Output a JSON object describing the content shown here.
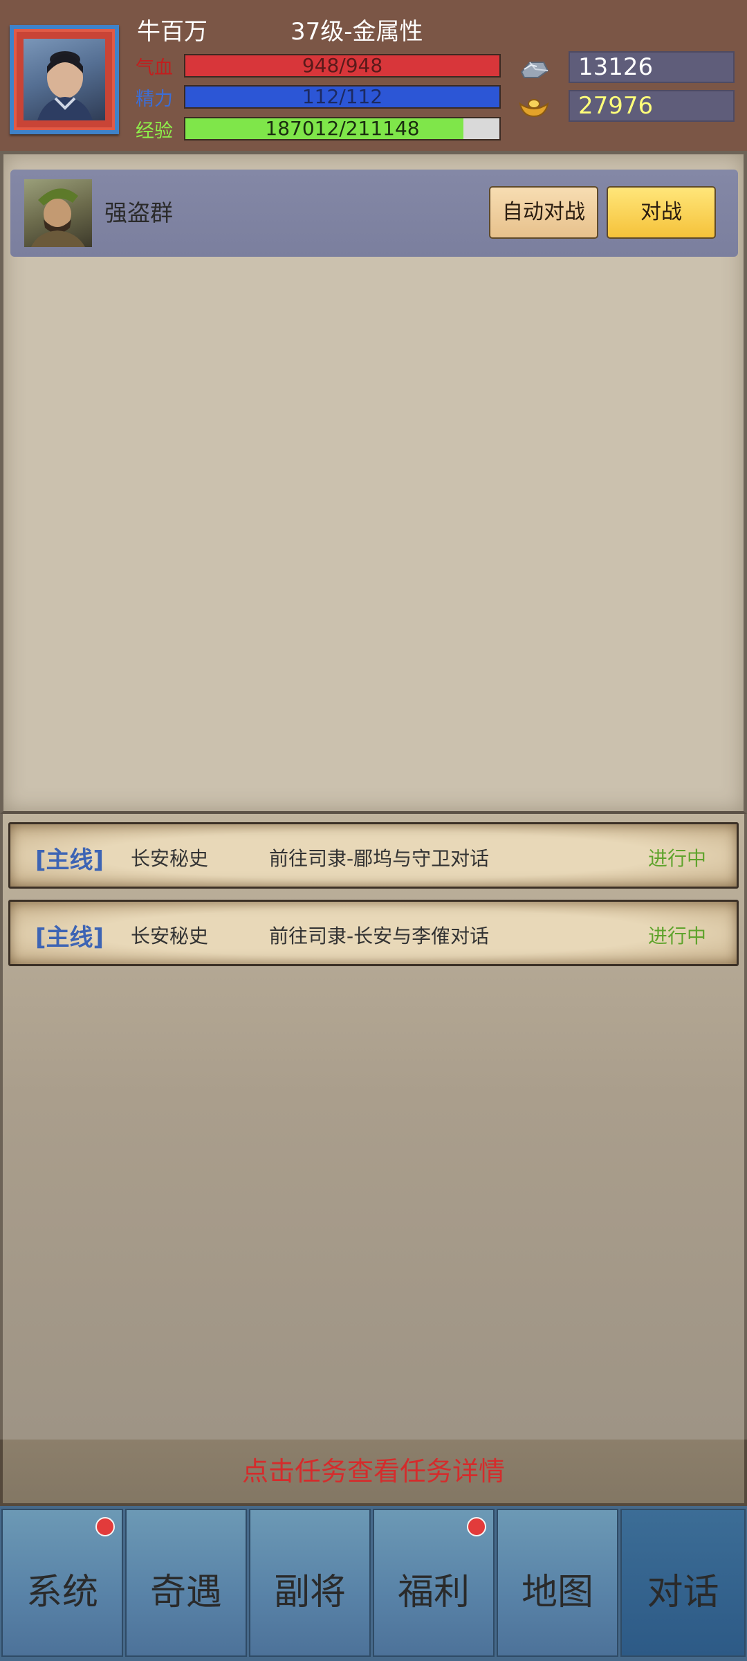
{
  "player": {
    "name": "牛百万",
    "level_text": "37级-金属性",
    "stats": {
      "hp": {
        "label": "气血",
        "text": "948/948",
        "fill": 1.0,
        "color": "#d8363a",
        "label_color": "#c21e1e"
      },
      "mp": {
        "label": "精力",
        "text": "112/112",
        "fill": 1.0,
        "color": "#2c56d6",
        "label_color": "#3c6ed6"
      },
      "exp": {
        "label": "经验",
        "text": "187012/211148",
        "fill": 0.886,
        "color": "#7fe64a",
        "label_color": "#8ef04a"
      }
    },
    "currencies": [
      {
        "icon": "silver-ingot-icon",
        "value": "13126",
        "color": "#ffffff"
      },
      {
        "icon": "gold-ingot-icon",
        "value": "27976",
        "color": "#ffff7a"
      }
    ]
  },
  "encounter": {
    "enemy_name": "强盗群",
    "auto_battle_label": "自动对战",
    "battle_label": "对战"
  },
  "quests": [
    {
      "type": "[主线]",
      "title": "长安秘史",
      "description": "前往司隶-郿坞与守卫对话",
      "status": "进行中"
    },
    {
      "type": "[主线]",
      "title": "长安秘史",
      "description": "前往司隶-长安与李傕对话",
      "status": "进行中"
    }
  ],
  "hint": "点击任务查看任务详情",
  "nav": [
    {
      "label": "系统",
      "badge": true
    },
    {
      "label": "奇遇",
      "badge": false
    },
    {
      "label": "副将",
      "badge": false
    },
    {
      "label": "福利",
      "badge": true
    },
    {
      "label": "地图",
      "badge": false
    },
    {
      "label": "对话",
      "badge": false,
      "active": true
    }
  ]
}
